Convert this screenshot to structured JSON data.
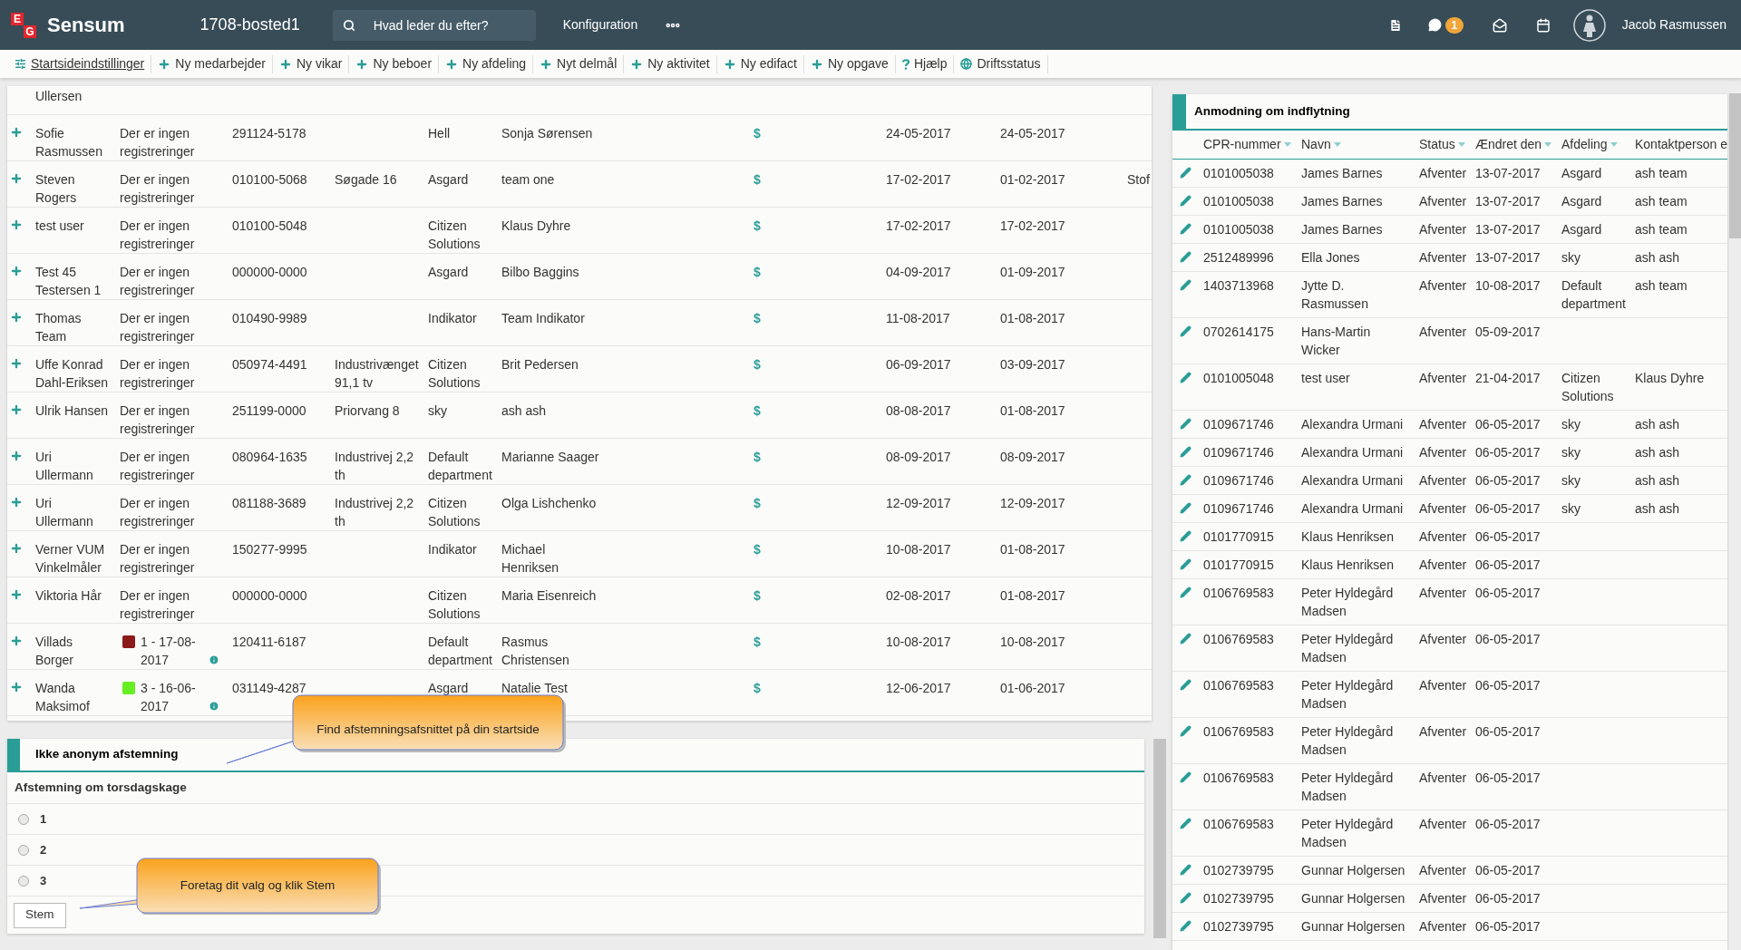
{
  "header": {
    "logo_letters": [
      "E",
      "G"
    ],
    "app_name": "Sensum",
    "context": "1708-bosted1",
    "search": {
      "placeholder": "Hvad leder du efter?"
    },
    "menu": "Konfiguration",
    "notification_count": "1",
    "user": "Jacob Rasmussen"
  },
  "toolbar": [
    {
      "label": "Startsideindstillinger",
      "kind": "settings"
    },
    {
      "label": "Ny medarbejder",
      "kind": "add"
    },
    {
      "label": "Ny vikar",
      "kind": "add"
    },
    {
      "label": "Ny beboer",
      "kind": "add"
    },
    {
      "label": "Ny afdeling",
      "kind": "add"
    },
    {
      "label": "Nyt delmål",
      "kind": "add"
    },
    {
      "label": "Ny aktivitet",
      "kind": "add"
    },
    {
      "label": "Ny edifact",
      "kind": "add"
    },
    {
      "label": "Ny opgave",
      "kind": "add"
    },
    {
      "label": "Hjælp",
      "kind": "help"
    },
    {
      "label": "Driftsstatus",
      "kind": "status"
    }
  ],
  "residents": {
    "partial_row": {
      "name": "Ullersen"
    },
    "rows": [
      {
        "name": "Sofie Rasmussen",
        "registration": {
          "kind": "empty",
          "text": "Der er ingen registreringer"
        },
        "cpr": "291124-5178",
        "address": "",
        "department": "Hell",
        "contact": "Sonja Sørensen",
        "column_7": "$",
        "date_1": "24-05-2017",
        "date_2": "24-05-2017",
        "column_10": ""
      },
      {
        "name": "Steven Rogers",
        "registration": {
          "kind": "empty",
          "text": "Der er ingen registreringer"
        },
        "cpr": "010100-5068",
        "address": "Søgade 16",
        "department": "Asgard",
        "contact": "team one",
        "column_7": "$",
        "date_1": "17-02-2017",
        "date_2": "01-02-2017",
        "column_10": "Stof"
      },
      {
        "name": "test user",
        "registration": {
          "kind": "empty",
          "text": "Der er ingen registreringer"
        },
        "cpr": "010100-5048",
        "address": "",
        "department": "Citizen Solutions",
        "contact": "Klaus Dyhre",
        "column_7": "$",
        "date_1": "17-02-2017",
        "date_2": "17-02-2017",
        "column_10": ""
      },
      {
        "name": "Test 45 Testersen 1",
        "registration": {
          "kind": "empty",
          "text": "Der er ingen registreringer"
        },
        "cpr": "000000-0000",
        "address": "",
        "department": "Asgard",
        "contact": "Bilbo Baggins",
        "column_7": "$",
        "date_1": "04-09-2017",
        "date_2": "01-09-2017",
        "column_10": ""
      },
      {
        "name": "Thomas Team",
        "registration": {
          "kind": "empty",
          "text": "Der er ingen registreringer"
        },
        "cpr": "010490-9989",
        "address": "",
        "department": "Indikator",
        "contact": "Team Indikator",
        "column_7": "$",
        "date_1": "11-08-2017",
        "date_2": "01-08-2017",
        "column_10": ""
      },
      {
        "name": "Uffe Konrad Dahl-Eriksen",
        "registration": {
          "kind": "empty",
          "text": "Der er ingen registreringer"
        },
        "cpr": "050974-4491",
        "address": "Industrivænget 91,1 tv",
        "department": "Citizen Solutions",
        "contact": "Brit Pedersen",
        "column_7": "$",
        "date_1": "06-09-2017",
        "date_2": "03-09-2017",
        "column_10": ""
      },
      {
        "name": "Ulrik Hansen",
        "registration": {
          "kind": "empty",
          "text": "Der er ingen registreringer"
        },
        "cpr": "251199-0000",
        "address": "Priorvang 8",
        "department": "sky",
        "contact": "ash ash",
        "column_7": "$",
        "date_1": "08-08-2017",
        "date_2": "01-08-2017",
        "column_10": ""
      },
      {
        "name": "Uri Ullermann",
        "registration": {
          "kind": "empty",
          "text": "Der er ingen registreringer"
        },
        "cpr": "080964-1635",
        "address": "Industrivej 2,2 th",
        "department": "Default department",
        "contact": "Marianne Saager",
        "column_7": "$",
        "date_1": "08-09-2017",
        "date_2": "08-09-2017",
        "column_10": ""
      },
      {
        "name": "Uri Ullermann",
        "registration": {
          "kind": "empty",
          "text": "Der er ingen registreringer"
        },
        "cpr": "081188-3689",
        "address": "Industrivej 2,2 th",
        "department": "Citizen Solutions",
        "contact": "Olga Lishchenko",
        "column_7": "$",
        "date_1": "12-09-2017",
        "date_2": "12-09-2017",
        "column_10": ""
      },
      {
        "name": "Verner VUM Vinkelmåler",
        "registration": {
          "kind": "empty",
          "text": "Der er ingen registreringer"
        },
        "cpr": "150277-9995",
        "address": "",
        "department": "Indikator",
        "contact": "Michael Henriksen",
        "column_7": "$",
        "date_1": "10-08-2017",
        "date_2": "01-08-2017",
        "column_10": ""
      },
      {
        "name": "Viktoria Hår",
        "registration": {
          "kind": "empty",
          "text": "Der er ingen registreringer"
        },
        "cpr": "000000-0000",
        "address": "",
        "department": "Citizen Solutions",
        "contact": "Maria Eisenreich",
        "column_7": "$",
        "date_1": "02-08-2017",
        "date_2": "01-08-2017",
        "column_10": ""
      },
      {
        "name": "Villads Borger",
        "registration": {
          "kind": "marked",
          "color": "#8b1a1a",
          "text": "1 - 17-08-2017"
        },
        "cpr": "120411-6187",
        "address": "",
        "department": "Default department",
        "contact": "Rasmus Christensen",
        "column_7": "$",
        "date_1": "10-08-2017",
        "date_2": "10-08-2017",
        "column_10": ""
      },
      {
        "name": "Wanda Maksimof",
        "registration": {
          "kind": "marked",
          "color": "#66ee22",
          "text": "3 - 16-06-2017"
        },
        "cpr": "031149-4287",
        "address": "",
        "department": "Asgard",
        "contact": "Natalie Test",
        "column_7": "$",
        "date_1": "12-06-2017",
        "date_2": "01-06-2017",
        "column_10": ""
      }
    ]
  },
  "poll": {
    "title": "Ikke anonym afstemning",
    "question": "Afstemning om torsdagskage",
    "options": [
      {
        "label": "1",
        "selected": false
      },
      {
        "label": "2",
        "selected": false
      },
      {
        "label": "3",
        "selected": false
      }
    ],
    "button": "Stem"
  },
  "callouts": [
    {
      "text": "Find afstemningsafsnittet på din startside"
    },
    {
      "text": "Foretag dit valg og klik Stem"
    }
  ],
  "requests": {
    "title": "Anmodning om indflytning",
    "columns": [
      {
        "label": "CPR-nummer",
        "sortable": true
      },
      {
        "label": "Navn",
        "sortable": true
      },
      {
        "label": "Status",
        "sortable": true
      },
      {
        "label": "Ændret den",
        "sortable": true
      },
      {
        "label": "Afdeling",
        "sortable": true
      },
      {
        "label": "Kontaktperson e",
        "sortable": false
      }
    ],
    "rows": [
      {
        "cpr": "0101005038",
        "name": "James Barnes",
        "status": "Afventer",
        "changed": "13-07-2017",
        "department": "Asgard",
        "contact": "ash team"
      },
      {
        "cpr": "0101005038",
        "name": "James Barnes",
        "status": "Afventer",
        "changed": "13-07-2017",
        "department": "Asgard",
        "contact": "ash team"
      },
      {
        "cpr": "0101005038",
        "name": "James Barnes",
        "status": "Afventer",
        "changed": "13-07-2017",
        "department": "Asgard",
        "contact": "ash team"
      },
      {
        "cpr": "2512489996",
        "name": "Ella Jones",
        "status": "Afventer",
        "changed": "13-07-2017",
        "department": "sky",
        "contact": "ash ash"
      },
      {
        "cpr": "1403713968",
        "name": "Jytte D. Rasmussen",
        "status": "Afventer",
        "changed": "10-08-2017",
        "department": "Default department",
        "contact": "ash team"
      },
      {
        "cpr": "0702614175",
        "name": "Hans-Martin Wicker",
        "status": "Afventer",
        "changed": "05-09-2017",
        "department": "",
        "contact": ""
      },
      {
        "cpr": "0101005048",
        "name": "test user",
        "status": "Afventer",
        "changed": "21-04-2017",
        "department": "Citizen Solutions",
        "contact": "Klaus Dyhre"
      },
      {
        "cpr": "0109671746",
        "name": "Alexandra Urmani",
        "status": "Afventer",
        "changed": "06-05-2017",
        "department": "sky",
        "contact": "ash ash"
      },
      {
        "cpr": "0109671746",
        "name": "Alexandra Urmani",
        "status": "Afventer",
        "changed": "06-05-2017",
        "department": "sky",
        "contact": "ash ash"
      },
      {
        "cpr": "0109671746",
        "name": "Alexandra Urmani",
        "status": "Afventer",
        "changed": "06-05-2017",
        "department": "sky",
        "contact": "ash ash"
      },
      {
        "cpr": "0109671746",
        "name": "Alexandra Urmani",
        "status": "Afventer",
        "changed": "06-05-2017",
        "department": "sky",
        "contact": "ash ash"
      },
      {
        "cpr": "0101770915",
        "name": "Klaus Henriksen",
        "status": "Afventer",
        "changed": "06-05-2017",
        "department": "",
        "contact": ""
      },
      {
        "cpr": "0101770915",
        "name": "Klaus Henriksen",
        "status": "Afventer",
        "changed": "06-05-2017",
        "department": "",
        "contact": ""
      },
      {
        "cpr": "0106769583",
        "name": "Peter Hyldegård Madsen",
        "status": "Afventer",
        "changed": "06-05-2017",
        "department": "",
        "contact": ""
      },
      {
        "cpr": "0106769583",
        "name": "Peter Hyldegård Madsen",
        "status": "Afventer",
        "changed": "06-05-2017",
        "department": "",
        "contact": ""
      },
      {
        "cpr": "0106769583",
        "name": "Peter Hyldegård Madsen",
        "status": "Afventer",
        "changed": "06-05-2017",
        "department": "",
        "contact": ""
      },
      {
        "cpr": "0106769583",
        "name": "Peter Hyldegård Madsen",
        "status": "Afventer",
        "changed": "06-05-2017",
        "department": "",
        "contact": ""
      },
      {
        "cpr": "0106769583",
        "name": "Peter Hyldegård Madsen",
        "status": "Afventer",
        "changed": "06-05-2017",
        "department": "",
        "contact": ""
      },
      {
        "cpr": "0106769583",
        "name": "Peter Hyldegård Madsen",
        "status": "Afventer",
        "changed": "06-05-2017",
        "department": "",
        "contact": ""
      },
      {
        "cpr": "0102739795",
        "name": "Gunnar Holgersen",
        "status": "Afventer",
        "changed": "06-05-2017",
        "department": "",
        "contact": ""
      },
      {
        "cpr": "0102739795",
        "name": "Gunnar Holgersen",
        "status": "Afventer",
        "changed": "06-05-2017",
        "department": "",
        "contact": ""
      },
      {
        "cpr": "0102739795",
        "name": "Gunnar Holgersen",
        "status": "Afventer",
        "changed": "06-05-2017",
        "department": "",
        "contact": ""
      }
    ]
  }
}
